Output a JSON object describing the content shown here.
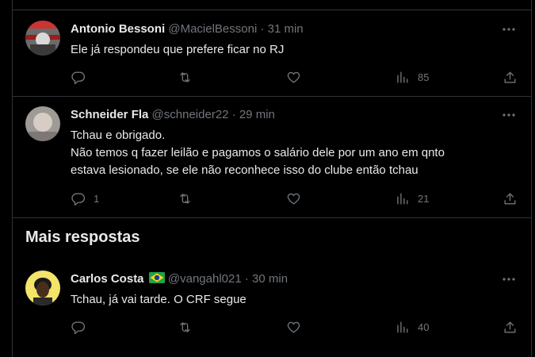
{
  "tweets": [
    {
      "name": "Antonio Bessoni",
      "handle": "@MacielBessoni",
      "sep": "·",
      "time": "31 min",
      "lines": [
        "Ele já respondeu que prefere ficar no RJ"
      ],
      "replies": "",
      "views": "85"
    },
    {
      "name": "Schneider Fla",
      "handle": "@schneider22",
      "sep": "·",
      "time": "29 min",
      "lines": [
        "Tchau e obrigado.",
        "Não temos q fazer leilão e pagamos o salário dele por um ano em qnto",
        "estava lesionado, se ele não reconhece isso do clube então tchau"
      ],
      "replies": "1",
      "views": "21"
    },
    {
      "name": "Carlos Costa",
      "handle": "@vangahl021",
      "sep": "·",
      "time": "30 min",
      "lines": [
        "Tchau, já vai tarde. O CRF segue"
      ],
      "replies": "",
      "views": "40"
    }
  ],
  "section": {
    "title": "Mais respostas"
  },
  "icons": {
    "reply": "reply-icon",
    "retweet": "retweet-icon",
    "like": "like-icon",
    "views": "views-icon",
    "share": "share-icon",
    "more": "more-icon",
    "flag": "brazil-flag-icon"
  },
  "colors": {
    "background": "#000000",
    "text": "#e7e9ea",
    "muted": "#71767b",
    "border": "#2f3336"
  }
}
